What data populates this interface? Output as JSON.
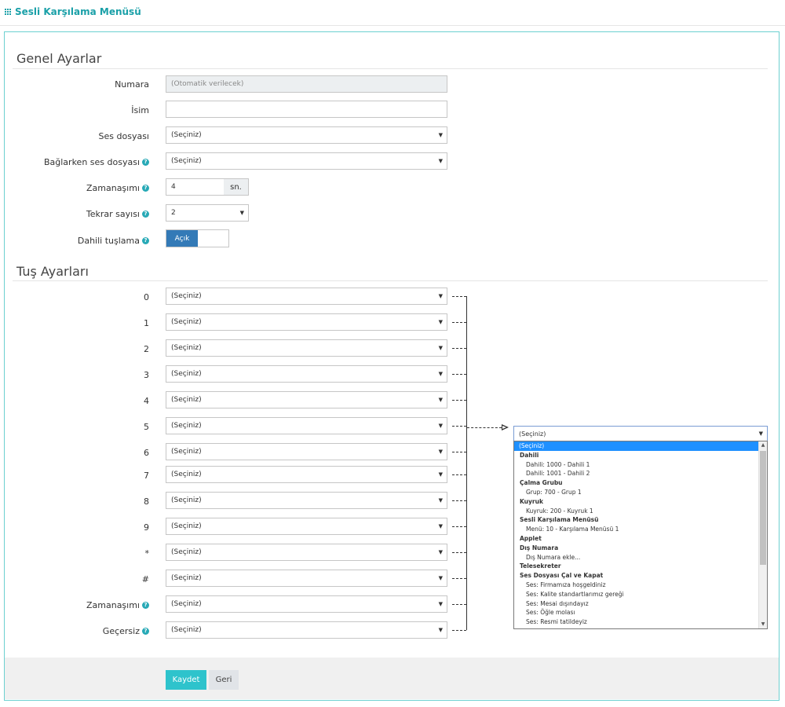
{
  "header": {
    "title": "Sesli Karşılama Menüsü"
  },
  "general": {
    "section_title": "Genel Ayarlar",
    "numara": {
      "label": "Numara",
      "placeholder": "(Otomatik verilecek)"
    },
    "isim": {
      "label": "İsim",
      "value": ""
    },
    "ses_dosyasi": {
      "label": "Ses dosyası",
      "value": "(Seçiniz)"
    },
    "baglarken": {
      "label": "Bağlarken ses dosyası",
      "value": "(Seçiniz)"
    },
    "zaman_asimi": {
      "label": "Zamanaşımı",
      "value": "4",
      "unit": "sn."
    },
    "tekrar": {
      "label": "Tekrar sayısı",
      "value": "2"
    },
    "dahili": {
      "label": "Dahili tuşlama",
      "toggle_label": "Açık",
      "on": true
    }
  },
  "keys": {
    "section_title": "Tuş Ayarları",
    "rows": [
      {
        "key": "0",
        "value": "(Seçiniz)"
      },
      {
        "key": "1",
        "value": "(Seçiniz)"
      },
      {
        "key": "2",
        "value": "(Seçiniz)"
      },
      {
        "key": "3",
        "value": "(Seçiniz)"
      },
      {
        "key": "4",
        "value": "(Seçiniz)"
      },
      {
        "key": "5",
        "value": "(Seçiniz)"
      },
      {
        "key": "6",
        "value": "(Seçiniz)"
      },
      {
        "key": "7",
        "value": "(Seçiniz)"
      },
      {
        "key": "8",
        "value": "(Seçiniz)"
      },
      {
        "key": "9",
        "value": "(Seçiniz)"
      },
      {
        "key": "*",
        "value": "(Seçiniz)"
      },
      {
        "key": "#",
        "value": "(Seçiniz)"
      },
      {
        "key": "Zamanaşımı",
        "value": "(Seçiniz)",
        "help": true
      },
      {
        "key": "Geçersiz",
        "value": "(Seçiniz)",
        "help": true
      }
    ]
  },
  "dropdown": {
    "selected": "(Seçiniz)",
    "items": [
      {
        "text": "(Seçiniz)",
        "kind": "sel"
      },
      {
        "text": "Dahili",
        "kind": "hdr"
      },
      {
        "text": "Dahili: 1000 - Dahili 1",
        "kind": "opt"
      },
      {
        "text": "Dahili: 1001 - Dahili 2",
        "kind": "opt"
      },
      {
        "text": "Çalma Grubu",
        "kind": "hdr"
      },
      {
        "text": "Grup: 700 - Grup 1",
        "kind": "opt"
      },
      {
        "text": "Kuyruk",
        "kind": "hdr"
      },
      {
        "text": "Kuyruk: 200 - Kuyruk 1",
        "kind": "opt"
      },
      {
        "text": "Sesli Karşılama Menüsü",
        "kind": "hdr"
      },
      {
        "text": "Menü: 10 - Karşılama Menüsü 1",
        "kind": "opt"
      },
      {
        "text": "Applet",
        "kind": "hdr"
      },
      {
        "text": "Dış Numara",
        "kind": "hdr"
      },
      {
        "text": "Dış Numara ekle...",
        "kind": "opt"
      },
      {
        "text": "Telesekreter",
        "kind": "hdr"
      },
      {
        "text": "Ses Dosyası Çal ve Kapat",
        "kind": "hdr"
      },
      {
        "text": "Ses: Firmamıza hoşgeldiniz",
        "kind": "opt"
      },
      {
        "text": "Ses: Kalite standartlarımız gereği",
        "kind": "opt"
      },
      {
        "text": "Ses: Mesai dışındayız",
        "kind": "opt"
      },
      {
        "text": "Ses: Öğle molası",
        "kind": "opt"
      },
      {
        "text": "Ses: Resmi tatildeyiz",
        "kind": "opt"
      }
    ]
  },
  "footer": {
    "save_label": "Kaydet",
    "back_label": "Geri"
  },
  "colors": {
    "accent": "#1aa0a8",
    "primary_button": "#2ec3cc",
    "toggle_on": "#337ab7",
    "dropdown_highlight": "#1e90ff"
  }
}
